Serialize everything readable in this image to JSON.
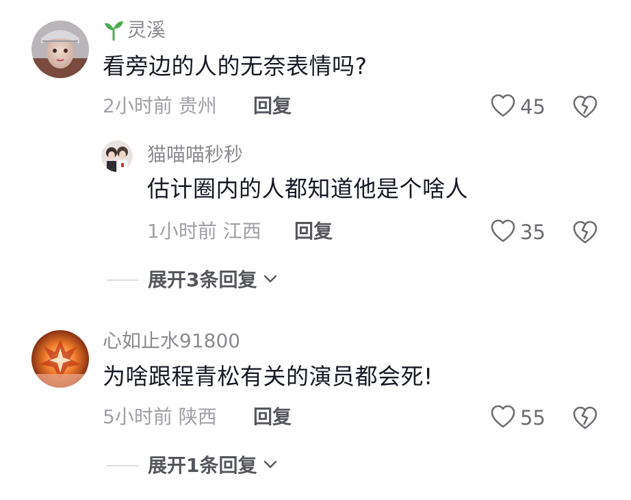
{
  "comments": [
    {
      "username": "灵溪",
      "text": "看旁边的人的无奈表情吗?",
      "time": "2小时前",
      "location": "贵州",
      "reply_label": "回复",
      "likes": "45",
      "replies": [
        {
          "username": "猫喵喵秒秒",
          "text": "估计圈内的人都知道他是个啥人",
          "time": "1小时前",
          "location": "江西",
          "reply_label": "回复",
          "likes": "35"
        }
      ],
      "expand_label": "展开3条回复"
    },
    {
      "username": "心如止水91800",
      "text": "为啥跟程青松有关的演员都会死!",
      "time": "5小时前",
      "location": "陕西",
      "reply_label": "回复",
      "likes": "55",
      "replies": [],
      "expand_label": "展开1条回复"
    }
  ],
  "icons": {
    "sprout": "sprout-icon",
    "like": "heart-outline-icon",
    "dislike": "broken-heart-icon",
    "chevron": "chevron-down-icon"
  },
  "colors": {
    "sprout": "#4caf50",
    "text": "#161823",
    "meta": "#9fa0a6"
  }
}
